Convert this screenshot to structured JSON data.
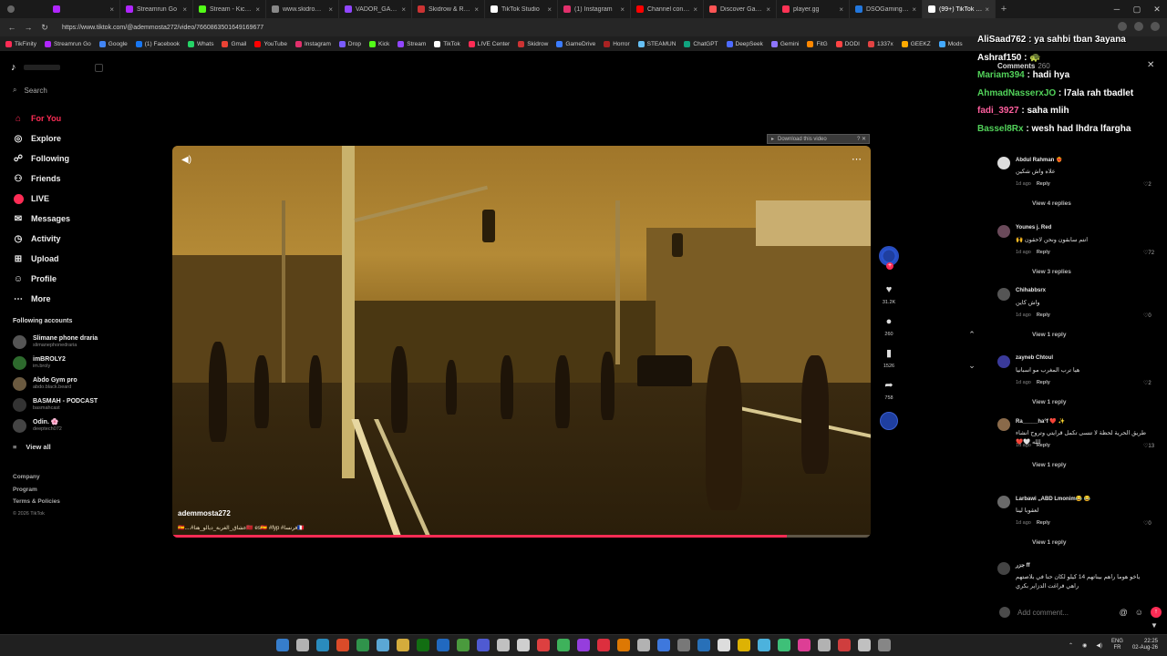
{
  "browser": {
    "tabs": [
      {
        "title": "",
        "color": "#b026ff"
      },
      {
        "title": "Streamrun Go",
        "color": "#b026ff"
      },
      {
        "title": "Stream - Kick Dashboard",
        "color": "#53fc18"
      },
      {
        "title": "www.skidrowreloaded...",
        "color": "#888888"
      },
      {
        "title": "VADOR_GAMING Strea...",
        "color": "#9146ff"
      },
      {
        "title": "Skidrow & Reloaded G...",
        "color": "#cc3333"
      },
      {
        "title": "TikTok Studio",
        "color": "#ffffff"
      },
      {
        "title": "(1) Instagram",
        "color": "#e1306c"
      },
      {
        "title": "Channel content - You...",
        "color": "#ff0000"
      },
      {
        "title": "Discover Games - Key...",
        "color": "#ff5555"
      },
      {
        "title": "player.gg",
        "color": "#ff3355"
      },
      {
        "title": "DSOGaming - PC Gam...",
        "color": "#2277dd"
      },
      {
        "title": "(99+) TikTok - Make...",
        "color": "#ffffff",
        "active": true
      }
    ],
    "url": "https://www.tiktok.com/@ademmosta272/video/7660863501649169677",
    "bookmarks": [
      {
        "label": "TikFinity",
        "color": "#fe2c55"
      },
      {
        "label": "Streamrun Go",
        "color": "#b026ff"
      },
      {
        "label": "Google",
        "color": "#4285f4"
      },
      {
        "label": "(1) Facebook",
        "color": "#1877f2"
      },
      {
        "label": "Whats",
        "color": "#25d366"
      },
      {
        "label": "Gmail",
        "color": "#ea4335"
      },
      {
        "label": "YouTube",
        "color": "#ff0000"
      },
      {
        "label": "Instagram",
        "color": "#e1306c"
      },
      {
        "label": "Drop",
        "color": "#7a5cff"
      },
      {
        "label": "Kick",
        "color": "#53fc18"
      },
      {
        "label": "Stream",
        "color": "#9146ff"
      },
      {
        "label": "TikTok",
        "color": "#ffffff"
      },
      {
        "label": "LIVE Center",
        "color": "#fe2c55"
      },
      {
        "label": "Skidrow",
        "color": "#cc3333"
      },
      {
        "label": "GameDrive",
        "color": "#3b7cff"
      },
      {
        "label": "Horror",
        "color": "#aa2222"
      },
      {
        "label": "STEAMUN",
        "color": "#66c0f4"
      },
      {
        "label": "ChatGPT",
        "color": "#10a37f"
      },
      {
        "label": "DeepSeek",
        "color": "#4d6bfe"
      },
      {
        "label": "Gemini",
        "color": "#8e75ff"
      },
      {
        "label": "FitG",
        "color": "#ff8800"
      },
      {
        "label": "DODI",
        "color": "#ff4444"
      },
      {
        "label": "1337x",
        "color": "#e24343"
      },
      {
        "label": "GEEKZ",
        "color": "#ffaa00"
      },
      {
        "label": "Mods",
        "color": "#44aaff"
      }
    ]
  },
  "sidebar": {
    "search_label": "Search",
    "nav": [
      {
        "label": "For You",
        "icon": "home-icon",
        "glyph": "⌂",
        "active": true
      },
      {
        "label": "Explore",
        "icon": "compass-icon",
        "glyph": "◎"
      },
      {
        "label": "Following",
        "icon": "following-icon",
        "glyph": "☍"
      },
      {
        "label": "Friends",
        "icon": "friends-icon",
        "glyph": "⚇"
      },
      {
        "label": "LIVE",
        "icon": "live-icon",
        "glyph": ""
      },
      {
        "label": "Messages",
        "icon": "messages-icon",
        "glyph": "✉",
        "badge": "99+"
      },
      {
        "label": "Activity",
        "icon": "activity-icon",
        "glyph": "◷"
      },
      {
        "label": "Upload",
        "icon": "upload-icon",
        "glyph": "⊞"
      },
      {
        "label": "Profile",
        "icon": "profile-icon",
        "glyph": "☺"
      },
      {
        "label": "More",
        "icon": "more-icon",
        "glyph": "⋯"
      }
    ],
    "following_title": "Following accounts",
    "accounts": [
      {
        "name": "Slimane phone draria",
        "handle": "slimanephonedraria",
        "color": "#555555"
      },
      {
        "name": "imBROLY2",
        "handle": "im.broly",
        "color": "#2d6a2d"
      },
      {
        "name": "Abdo Gym pro",
        "handle": "abdo.black.beard",
        "color": "#6b5a40"
      },
      {
        "name": "BASMAH - PODCAST",
        "handle": "basmahcast",
        "color": "#333333"
      },
      {
        "name": "Odin. 🌸",
        "handle": "deeptech072",
        "color": "#444444"
      }
    ],
    "view_all": "View all",
    "footer": [
      "Company",
      "Program",
      "Terms & Policies"
    ],
    "copyright": "© 2026 TikTok"
  },
  "video": {
    "author": "ademmosta272",
    "caption": "🇪🇸....#عشاق_الغربة_ديالو_هنا🇲🇦 es🇪🇸 #fyp #فرنسا🇫🇷",
    "progress": 0.88,
    "download_banner": "Download this video"
  },
  "actions": {
    "likes": "31.2K",
    "comments": "260",
    "saves": "1526",
    "shares": "758"
  },
  "stream_chat": [
    {
      "user": "AliSaad762",
      "text": "ya sahbi tban 3ayana",
      "color": "#ffffff"
    },
    {
      "user": "Ashraf150",
      "text": "🐢",
      "color": "#ffffff"
    },
    {
      "user": "Mariam394",
      "text": "hadi hya",
      "color": "#52d25a"
    },
    {
      "user": "AhmadNasserxJO",
      "text": "l7ala rah tbadlet",
      "color": "#52d25a"
    },
    {
      "user": "fadi_3927",
      "text": "saha mlih",
      "color": "#ff5f9e"
    },
    {
      "user": "Bassel8Rx",
      "text": "wesh had lhdra lfargha",
      "color": "#52d25a"
    }
  ],
  "comments": {
    "title": "Comments",
    "count": "260",
    "items": [
      {
        "user": "Abdul Rahman ❤️‍🔥",
        "text": "علاه واش شكين",
        "time": "1d ago",
        "reply": "Reply",
        "likes": "2",
        "more": "View 4 replies",
        "color": "#dddddd"
      },
      {
        "user": "Younes j. Red",
        "text": "انتم سابقون ونحن لاحقون 🙌",
        "time": "1d ago",
        "reply": "Reply",
        "likes": "72",
        "more": "View 3 replies",
        "color": "#6a4a5a"
      },
      {
        "user": "Chihabbsrx",
        "text": "واش كاين",
        "time": "1d ago",
        "reply": "Reply",
        "likes": "0",
        "more": "View 1 reply",
        "color": "#555555"
      },
      {
        "user": "zayneb Chtoul",
        "text": "هيا ترب المغرب مو اسبانيا",
        "time": "1d ago",
        "reply": "Reply",
        "likes": "2",
        "more": "View 1 reply",
        "color": "#3a3a9a"
      },
      {
        "user": "Ra_____ha°f ❤️ ✨",
        "text": "طريق الحرية لحظة لا تنسى تكمل قرايتي وتروح انشاء الله 🤍❤️",
        "time": "1d ago",
        "reply": "Reply",
        "likes": "13",
        "more": "View 1 reply",
        "color": "#8a6a4a"
      },
      {
        "user": "Larbawi ,,ABD Lmonim😂 😂",
        "text": "لعقوبا لينا",
        "time": "1d ago",
        "reply": "Reply",
        "likes": "0",
        "more": "View 1 reply",
        "color": "#6a6a6a"
      },
      {
        "user": "جزر ff",
        "text": "ياخو هوما راهم بيناتهم 14 كيلو لكان حنا في بلاصتهم راهي فراغت الدزاير بكري",
        "time": "",
        "reply": "",
        "likes": "",
        "more": "",
        "color": "#444444"
      }
    ],
    "input_placeholder": "Add comment..."
  },
  "taskbar": {
    "icons": [
      {
        "name": "windows-start-icon",
        "color": "#3b8eea"
      },
      {
        "name": "search-icon",
        "color": "#cccccc"
      },
      {
        "name": "edge-icon",
        "color": "#2d9fd9"
      },
      {
        "name": "brave-icon",
        "color": "#fb542b"
      },
      {
        "name": "chrome-icon",
        "color": "#34a853"
      },
      {
        "name": "steam-icon",
        "color": "#66c0f4"
      },
      {
        "name": "folder-icon",
        "color": "#f5c542"
      },
      {
        "name": "xbox-icon",
        "color": "#107c10"
      },
      {
        "name": "app-icon",
        "color": "#2277dd"
      },
      {
        "name": "xbox-app-icon",
        "color": "#52b043"
      },
      {
        "name": "discord-icon",
        "color": "#5865f2"
      },
      {
        "name": "obs-icon",
        "color": "#dddddd"
      },
      {
        "name": "epic-icon",
        "color": "#eeeeee"
      },
      {
        "name": "ea-icon",
        "color": "#ff4747"
      },
      {
        "name": "media-icon",
        "color": "#44cc66"
      },
      {
        "name": "app2-icon",
        "color": "#aa44ff"
      },
      {
        "name": "app3-icon",
        "color": "#ff3344"
      },
      {
        "name": "app4-icon",
        "color": "#ff8800"
      },
      {
        "name": "app5-icon",
        "color": "#cccccc"
      },
      {
        "name": "app6-icon",
        "color": "#4488ff"
      },
      {
        "name": "app7-icon",
        "color": "#888888"
      },
      {
        "name": "app8-icon",
        "color": "#2a7fd4"
      },
      {
        "name": "app9-icon",
        "color": "#ffffff"
      },
      {
        "name": "app10-icon",
        "color": "#ffcc00"
      },
      {
        "name": "app11-icon",
        "color": "#55ccff"
      },
      {
        "name": "app12-icon",
        "color": "#44dd88"
      },
      {
        "name": "app13-icon",
        "color": "#ff44aa"
      },
      {
        "name": "app14-icon",
        "color": "#cccccc"
      },
      {
        "name": "app15-icon",
        "color": "#ee4444"
      },
      {
        "name": "app16-icon",
        "color": "#dddddd"
      },
      {
        "name": "app17-icon",
        "color": "#999999"
      }
    ],
    "lang_top": "ENG",
    "lang_bottom": "FR",
    "time": "22:25",
    "date": "02-Aug-26"
  }
}
